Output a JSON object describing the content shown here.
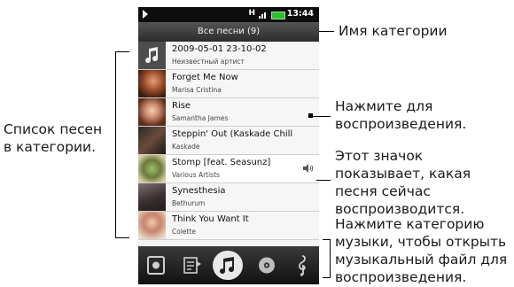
{
  "status_bar": {
    "time": "13:44",
    "network": "H"
  },
  "header": {
    "title": "Все песни (9)"
  },
  "songs": [
    {
      "title": "2009-05-01 23-10-02",
      "artist": "Неизвестный артист"
    },
    {
      "title": "Forget Me Now",
      "artist": "Marisa Cristina"
    },
    {
      "title": "Rise",
      "artist": "Samantha James"
    },
    {
      "title": "Steppin' Out (Kaskade Chill",
      "artist": "Kaskade"
    },
    {
      "title": "Stomp [feat. Seasunz]",
      "artist": "Various Artists",
      "playing": true
    },
    {
      "title": "Synesthesia",
      "artist": "Bethurum"
    },
    {
      "title": "Think You Want It",
      "artist": "Colette"
    }
  ],
  "tabs": [
    {
      "icon": "library-icon"
    },
    {
      "icon": "playlist-icon"
    },
    {
      "icon": "songs-icon",
      "selected": true
    },
    {
      "icon": "albums-icon"
    },
    {
      "icon": "composers-icon"
    }
  ],
  "annotations": {
    "category_name": "Имя категории",
    "song_list": "Список песен в категории.",
    "tap_to_play": "Нажмите для воспроизведения.",
    "now_playing": "Этот значок показывает, какая песня сейчас воспроизводится.",
    "tap_category": "Нажмите категорию музыки, чтобы открыть музыкальный файл для воспроизведения."
  },
  "colors": {
    "header_bg": "#3a3a3a",
    "list_bg": "#f6f6f6",
    "battery": "#2dbf2d"
  }
}
